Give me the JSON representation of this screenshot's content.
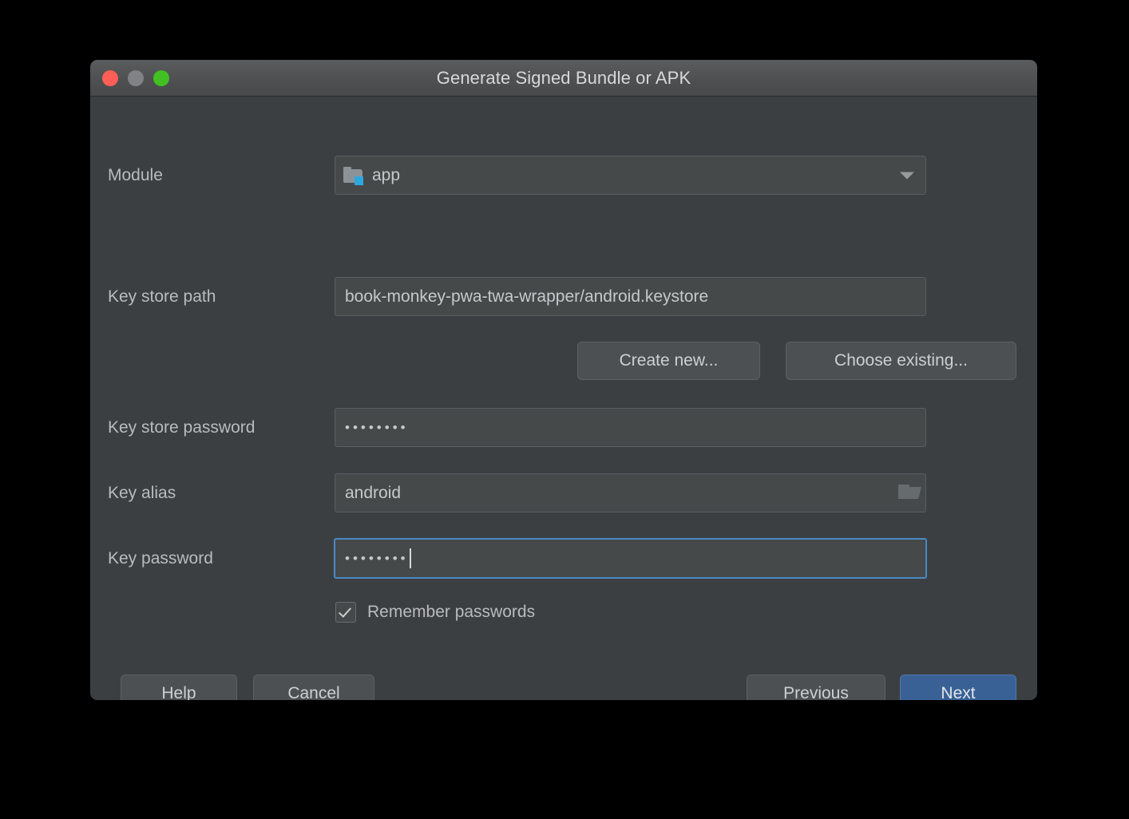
{
  "window": {
    "title": "Generate Signed Bundle or APK",
    "traffic_lights": [
      {
        "name": "close",
        "color": "#ff5f56"
      },
      {
        "name": "minimize",
        "color": "#808285"
      },
      {
        "name": "zoom",
        "color": "#42c023"
      }
    ]
  },
  "colors": {
    "dialog_background": "#3c3f41",
    "titlebar_background": "#4e5051",
    "field_background": "#45494a",
    "field_border": "#5a5e60",
    "focus_border": "#4a88c7",
    "primary_button": "#3a6196",
    "text": "#b9bcbd",
    "module_badge": "#2ea8e0"
  },
  "form": {
    "module": {
      "label": "Module",
      "value": "app",
      "icon": "module-folder-icon",
      "dropdown_icon": "chevron-down-icon"
    },
    "keystore_path": {
      "label": "Key store path",
      "value": "book-monkey-pwa-twa-wrapper/android.keystore",
      "placeholder": ""
    },
    "create_new": {
      "label": "Create new..."
    },
    "choose_existing": {
      "label": "Choose existing..."
    },
    "keystore_password": {
      "label": "Key store password",
      "value": "••••••••",
      "masked_length": 8
    },
    "key_alias": {
      "label": "Key alias",
      "value": "android",
      "icon": "folder-open-icon"
    },
    "key_password": {
      "label": "Key password",
      "value": "••••••••",
      "masked_length": 8,
      "focused": true
    },
    "remember_passwords": {
      "label": "Remember passwords",
      "checked": true
    }
  },
  "footer": {
    "help": "Help",
    "cancel": "Cancel",
    "previous": "Previous",
    "next": "Next"
  }
}
